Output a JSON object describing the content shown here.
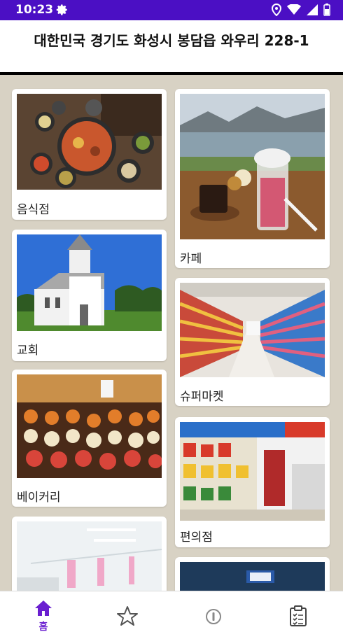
{
  "status_bar": {
    "time": "10:23"
  },
  "header": {
    "title": "대한민국 경기도 화성시 봉담읍 와우리 228-1"
  },
  "categories": [
    {
      "label": "음식점",
      "image": "korean-food-table-photo"
    },
    {
      "label": "카페",
      "image": "cafe-drinks-lake-photo"
    },
    {
      "label": "교회",
      "image": "white-church-photo"
    },
    {
      "label": "슈퍼마켓",
      "image": "supermarket-aisle-photo"
    },
    {
      "label": "베이커리",
      "image": "bakery-pastries-photo"
    },
    {
      "label": "편의점",
      "image": "convenience-store-photo"
    },
    {
      "label": "",
      "image": "hospital-room-photo"
    },
    {
      "label": "",
      "image": "atm-photo"
    }
  ],
  "bottom_nav": {
    "home_label": "홈",
    "items": [
      "home-icon",
      "star-icon",
      "info-icon",
      "clipboard-icon"
    ]
  },
  "colors": {
    "accent": "#4b0fc4",
    "nav_active": "#6a1fd0",
    "background": "#d8d2c4"
  }
}
